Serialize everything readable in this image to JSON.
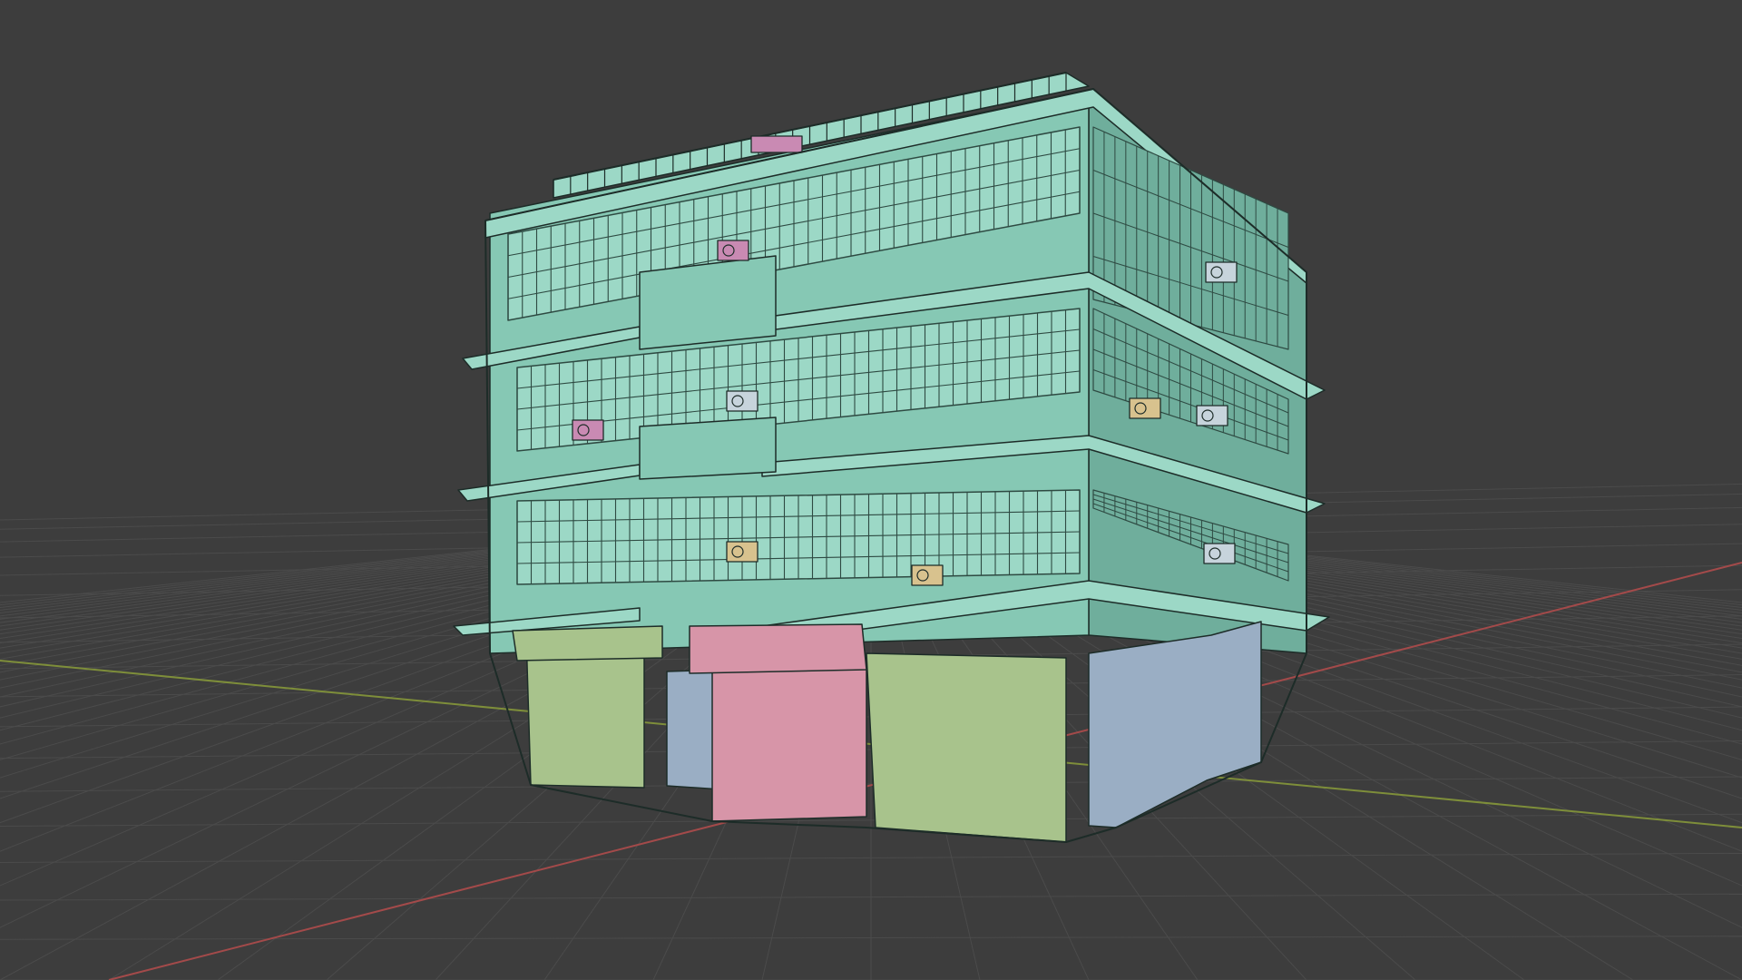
{
  "viewport": {
    "view": "3D Viewport",
    "shading": "solid",
    "show_floor_grid": true,
    "axes_shown": [
      "X",
      "Y"
    ]
  },
  "colors": {
    "background": "#3d3d3d",
    "grid_line": "#4b4b4b",
    "axis_x": "#a34a4a",
    "axis_y": "#7e8e3a",
    "facade": "#86c8b4",
    "facade_light": "#9cd8c6",
    "facade_shade": "#6fae9c",
    "window_grid": "#2e4a42",
    "outline": "#1d2c28",
    "shop_green": "#a8c38c",
    "shop_pink": "#d795a8",
    "shop_blue": "#9aaec4",
    "ac_pink": "#c98ab3",
    "ac_tan": "#d8c28e",
    "ac_grey": "#c7d4dc"
  },
  "scene": {
    "objects": [
      {
        "name": "building-main",
        "material": "facade"
      },
      {
        "name": "roof-railing",
        "material": "facade"
      },
      {
        "name": "shop-green-left",
        "material": "shop_green"
      },
      {
        "name": "shop-blue-door",
        "material": "shop_blue"
      },
      {
        "name": "shop-pink-entrance",
        "material": "shop_pink"
      },
      {
        "name": "shop-green-right",
        "material": "shop_green"
      },
      {
        "name": "shop-blue-side",
        "material": "shop_blue"
      },
      {
        "name": "ac-unit",
        "count": 9
      }
    ]
  }
}
